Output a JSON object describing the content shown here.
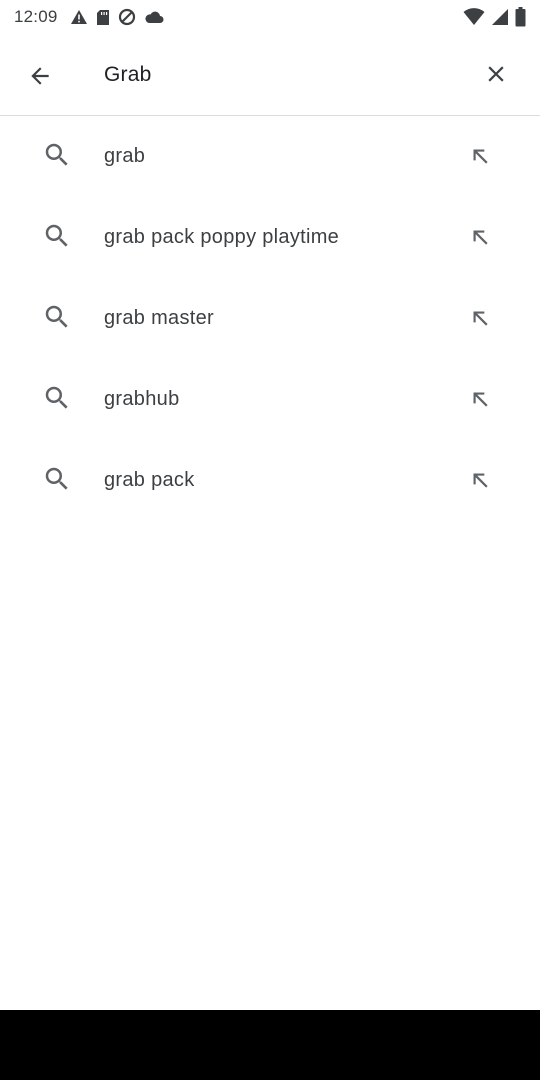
{
  "status_bar": {
    "time": "12:09",
    "left_icons": [
      "alert-triangle-icon",
      "sd-card-icon",
      "data-saver-icon",
      "cloud-icon"
    ],
    "right_icons": [
      "wifi-icon",
      "cellular-signal-icon",
      "battery-icon"
    ]
  },
  "search": {
    "query": "Grab",
    "back_icon": "arrow-back-icon",
    "clear_icon": "close-icon"
  },
  "suggestions": [
    {
      "label": "grab"
    },
    {
      "label": "grab pack poppy playtime"
    },
    {
      "label": "grab master"
    },
    {
      "label": "grabhub"
    },
    {
      "label": "grab pack"
    }
  ],
  "colors": {
    "text_primary": "#202124",
    "text_secondary": "#3c4043",
    "icon": "#5f6368",
    "divider": "#dadce0",
    "nav_bar": "#000000"
  }
}
